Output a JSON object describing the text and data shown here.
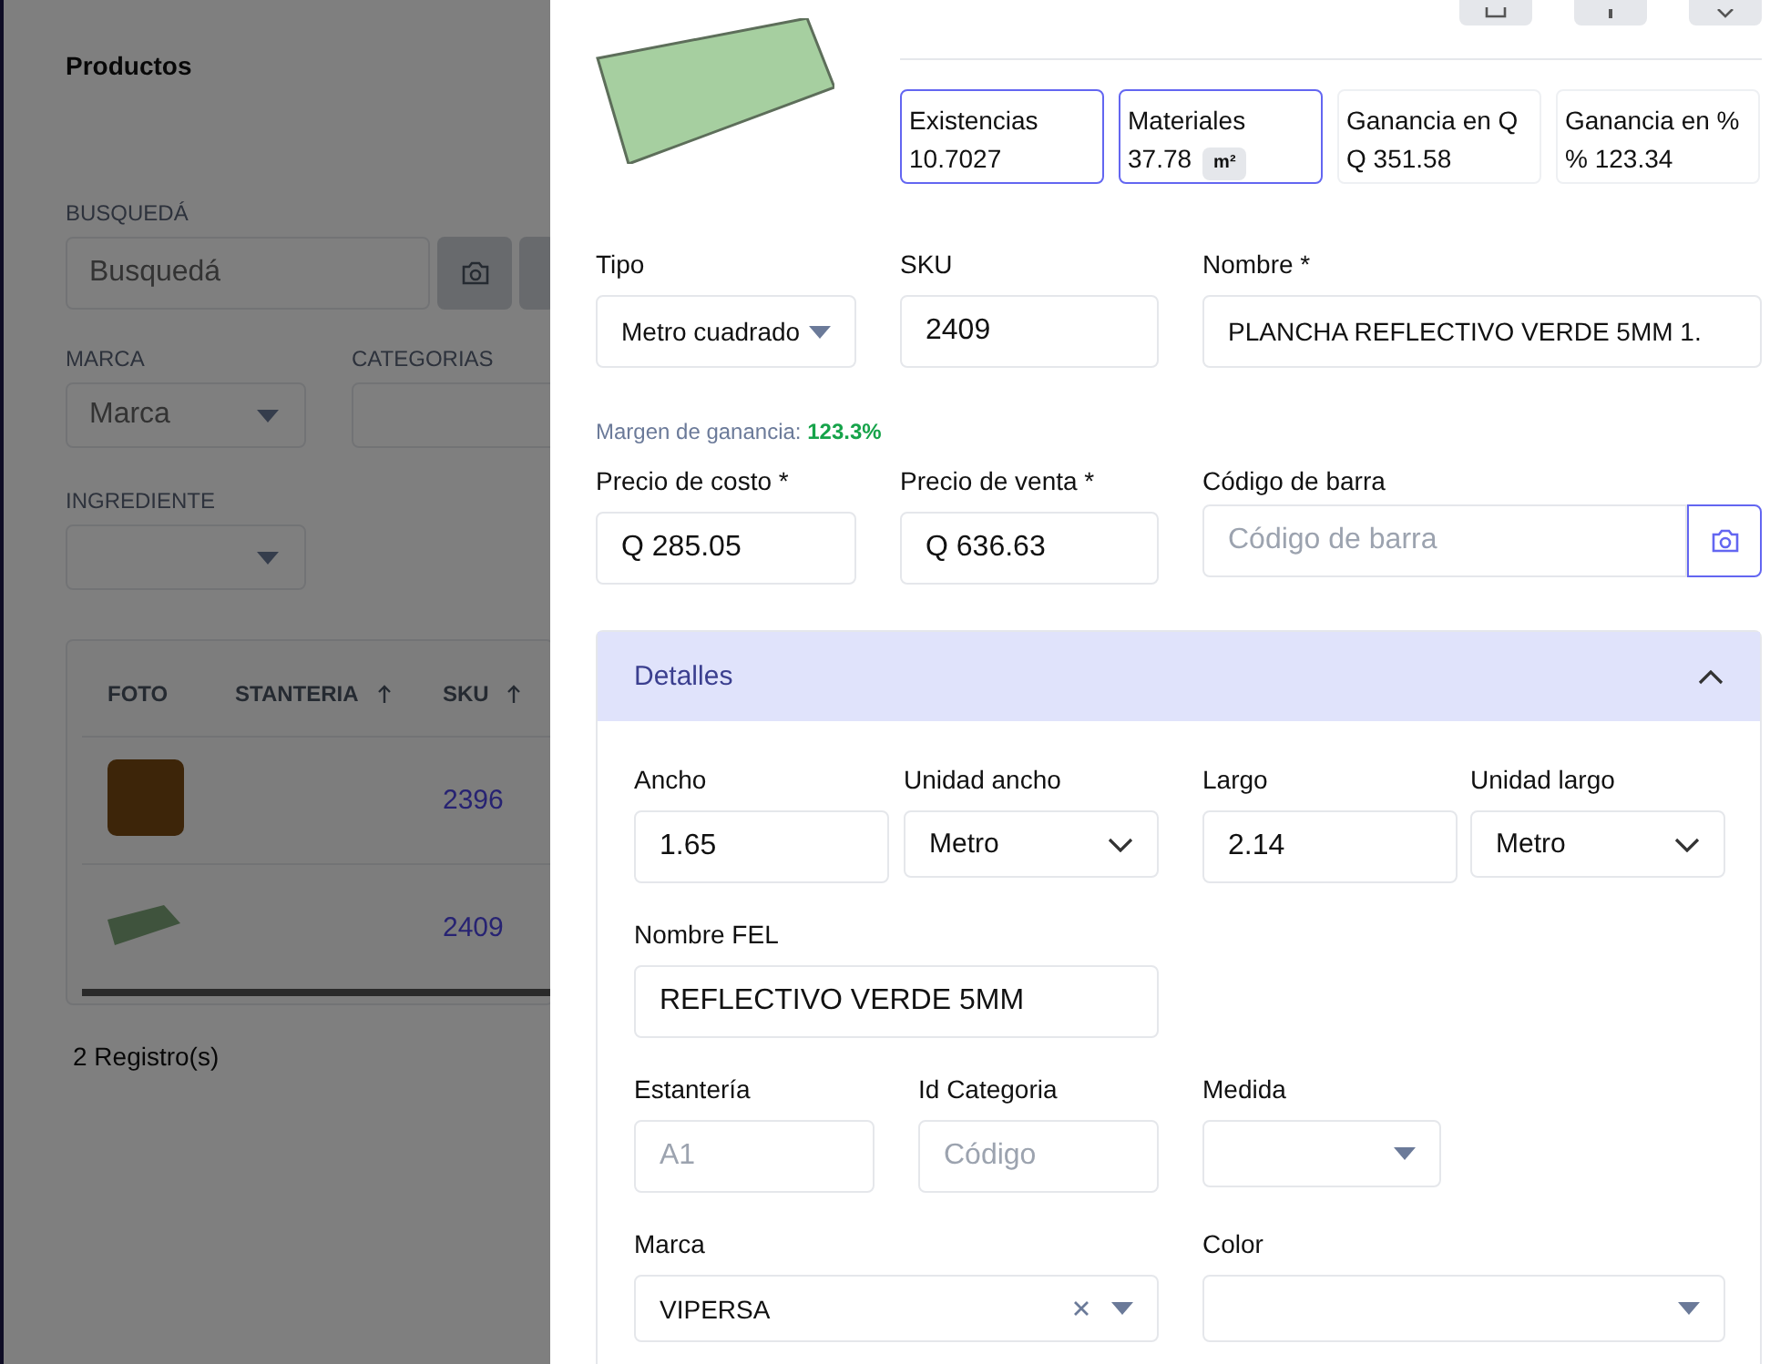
{
  "background_page": {
    "title": "Productos",
    "search": {
      "label": "BUSQUEDÁ",
      "placeholder": "Busquedá"
    },
    "filters": [
      {
        "label": "MARCA",
        "kind": "select",
        "placeholder": "Marca"
      },
      {
        "label": "CATEGORIAS",
        "kind": "text"
      },
      {
        "label": "INGREDIENTE",
        "kind": "select"
      }
    ],
    "table": {
      "columns": [
        {
          "label": "FOTO",
          "sortable": false
        },
        {
          "label": "STANTERIA",
          "sortable": true
        },
        {
          "label": "SKU",
          "sortable": true
        }
      ],
      "rows": [
        {
          "kind": "tile",
          "sku": "2396"
        },
        {
          "kind": "sheet",
          "sku": "2409"
        }
      ]
    },
    "record_count": "2 Registro(s)"
  },
  "drawer": {
    "stats": [
      {
        "label": "Existencias",
        "value": "10.7027",
        "highlighted": true
      },
      {
        "label": "Materiales",
        "value": "37.78",
        "unit": "m²",
        "highlighted": true
      },
      {
        "label": "Ganancia en Q",
        "value": "Q 351.58",
        "highlighted": false
      },
      {
        "label": "Ganancia en %",
        "value": "% 123.34",
        "highlighted": false
      }
    ],
    "top_fields": [
      {
        "label": "Tipo",
        "kind": "select",
        "value": "Metro cuadrado"
      },
      {
        "label": "SKU",
        "kind": "text",
        "value": "2409"
      },
      {
        "label": "Nombre *",
        "kind": "text",
        "value": "PLANCHA REFLECTIVO VERDE 5MM 1."
      }
    ],
    "margin_note": "Margen de ganancia: **123.3%**",
    "price_fields": [
      {
        "label": "Precio de costo *",
        "kind": "money",
        "prefix": "Q",
        "value": "285.05"
      },
      {
        "label": "Precio de venta *",
        "kind": "money",
        "prefix": "Q",
        "value": "636.63"
      },
      {
        "label": "Código de barra",
        "kind": "scan",
        "placeholder": "Código de barra"
      }
    ],
    "details": {
      "title": "Detalles",
      "expanded": true,
      "fields": [
        {
          "label": "Ancho",
          "kind": "text",
          "value": "1.65"
        },
        {
          "label": "Unidad ancho",
          "kind": "dropdown",
          "value": "Metro"
        },
        {
          "label": "Largo",
          "kind": "text",
          "value": "2.14"
        },
        {
          "label": "Unidad largo",
          "kind": "dropdown",
          "value": "Metro"
        },
        {
          "label": "Nombre FEL",
          "kind": "text",
          "value": "REFLECTIVO VERDE 5MM"
        },
        {
          "label": "Estantería",
          "kind": "text",
          "placeholder": "A1"
        },
        {
          "label": "Id Categoria",
          "kind": "text",
          "placeholder": "Código"
        },
        {
          "label": "Medida",
          "kind": "select"
        },
        {
          "label": "Marca",
          "kind": "clearable",
          "value": "VIPERSA"
        },
        {
          "label": "Color",
          "kind": "select"
        }
      ]
    }
  }
}
